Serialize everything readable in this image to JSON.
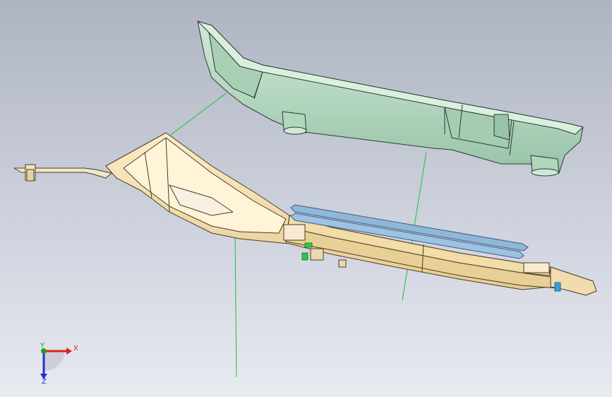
{
  "colors": {
    "background_top": "#aeb4c2",
    "background_bottom": "#e8eaf2",
    "cover_fill": "#b9dcc4",
    "cover_dark": "#8fb9a0",
    "cover_edge": "#2e3a33",
    "base_fill": "#f5e2b0",
    "base_dark": "#dcc188",
    "base_edge": "#4a3d26",
    "seal_fill": "#8fb7d9",
    "seal_edge": "#3a5d80",
    "construction_line": "#1fbf3a",
    "axis_x": "#e02020",
    "axis_y": "#20a020",
    "axis_z": "#2030d0"
  },
  "icons": {
    "triad": "coordinate-triad-icon",
    "small_part": "green-clip-icon"
  },
  "triad": {
    "x_label": "X",
    "y_label": "Y",
    "z_label": "Z"
  }
}
